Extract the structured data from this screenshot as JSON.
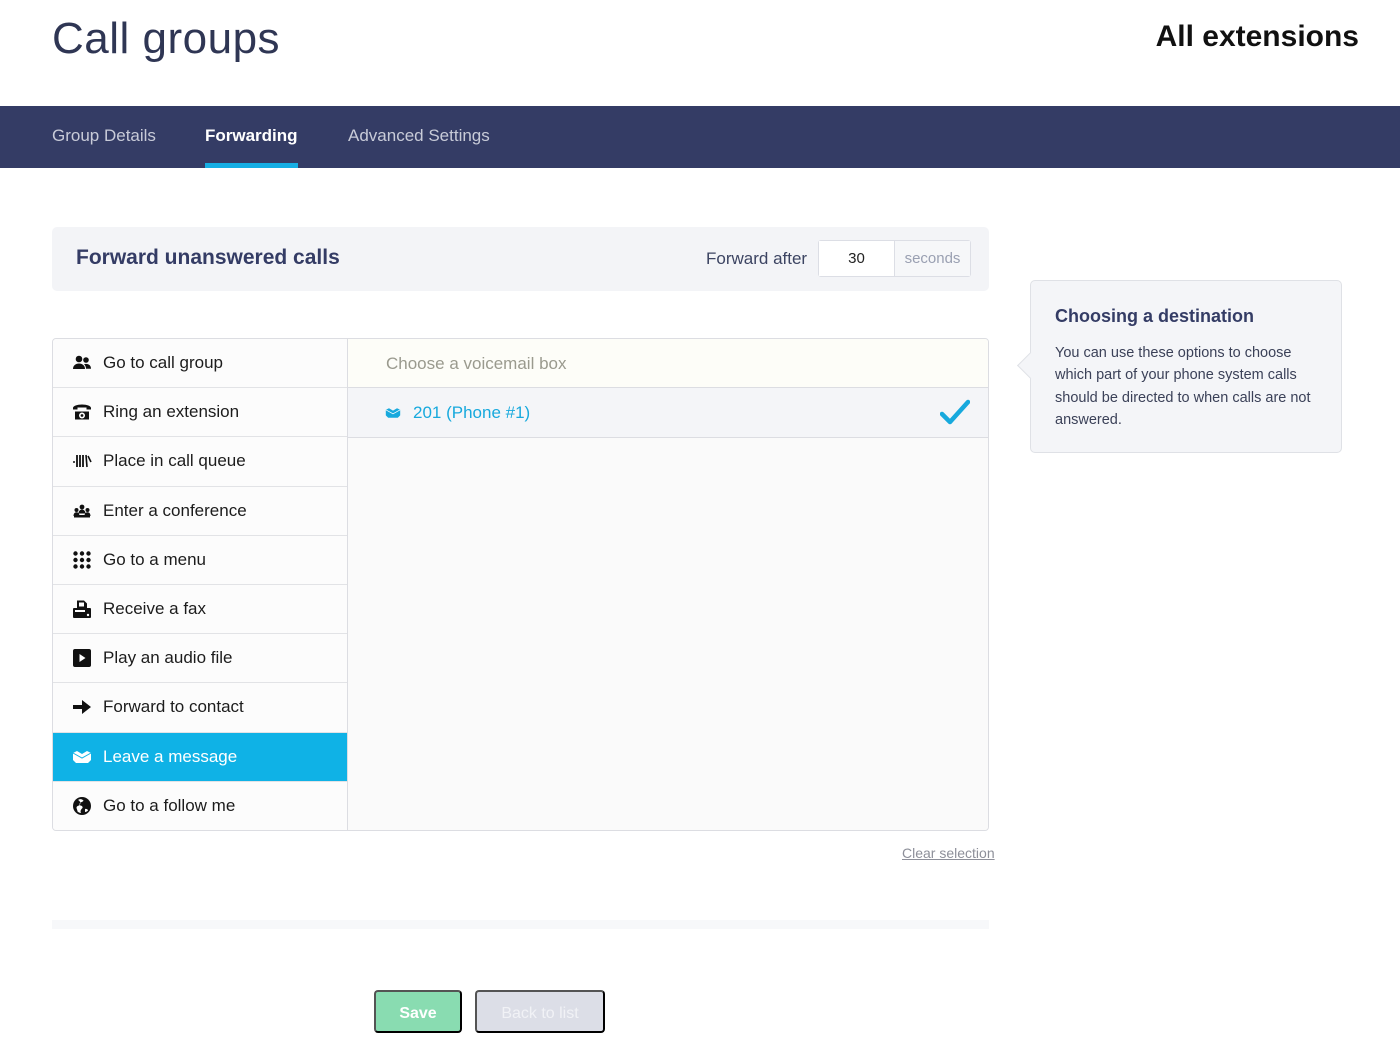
{
  "header": {
    "title": "Call groups",
    "right_title": "All extensions"
  },
  "tabs": [
    {
      "label": "Group Details",
      "active": false
    },
    {
      "label": "Forwarding",
      "active": true
    },
    {
      "label": "Advanced Settings",
      "active": false
    }
  ],
  "forward_panel": {
    "title": "Forward unanswered calls",
    "after_label": "Forward after",
    "after_value": "30",
    "unit": "seconds"
  },
  "destinations": [
    {
      "label": "Go to call group",
      "icon": "users-icon",
      "selected": false
    },
    {
      "label": "Ring an extension",
      "icon": "telephone-icon",
      "selected": false
    },
    {
      "label": "Place in call queue",
      "icon": "call-queue-icon",
      "selected": false
    },
    {
      "label": "Enter a conference",
      "icon": "conference-icon",
      "selected": false
    },
    {
      "label": "Go to a menu",
      "icon": "keypad-icon",
      "selected": false
    },
    {
      "label": "Receive a fax",
      "icon": "fax-icon",
      "selected": false
    },
    {
      "label": "Play an audio file",
      "icon": "play-icon",
      "selected": false
    },
    {
      "label": "Forward to contact",
      "icon": "arrow-right-icon",
      "selected": false
    },
    {
      "label": "Leave a message",
      "icon": "voicemail-icon",
      "selected": true
    },
    {
      "label": "Go to a follow me",
      "icon": "globe-icon",
      "selected": false
    }
  ],
  "options": {
    "header": "Choose a voicemail box",
    "items": [
      {
        "label": "201 (Phone #1)",
        "icon": "voicemail-icon",
        "checked": true
      }
    ]
  },
  "clear_selection": "Clear selection",
  "buttons": {
    "save": "Save",
    "back": "Back to list"
  },
  "help": {
    "title": "Choosing a destination",
    "text": "You can use these options to choose which part of your phone system calls should be directed to when calls are not answered."
  },
  "colors": {
    "nav_bg": "#343c65",
    "accent": "#0fb2e6",
    "save_green": "#89dcb1"
  }
}
